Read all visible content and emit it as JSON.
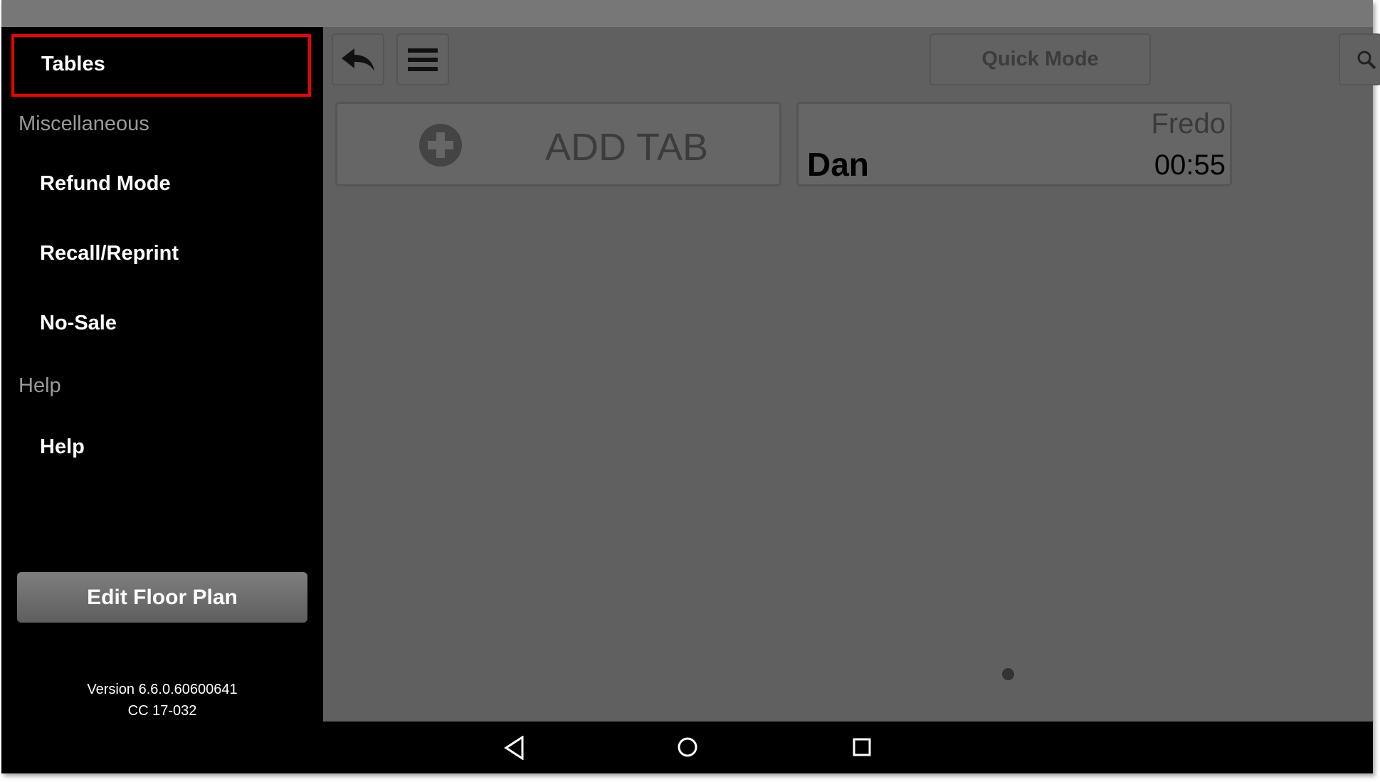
{
  "sidebar": {
    "selected": "Tables",
    "sections": [
      {
        "header": "Miscellaneous",
        "items": [
          "Refund Mode",
          "Recall/Reprint",
          "No-Sale"
        ]
      },
      {
        "header": "Help",
        "items": [
          "Help"
        ]
      }
    ],
    "edit_floor_plan": "Edit Floor Plan",
    "version": "Version 6.6.0.60600641",
    "cc": "CC 17-032"
  },
  "toolbar": {
    "quick_mode": "Quick Mode",
    "icons": [
      "back-arrow-icon",
      "hamburger-menu-icon",
      "search-icon"
    ]
  },
  "tabs": {
    "add_tab": "ADD TAB",
    "cards": [
      {
        "name": "Dan",
        "server": "Fredo",
        "time": "00:55"
      }
    ]
  },
  "pager": {
    "pages": 1,
    "current": 1
  },
  "colors": {
    "highlight": "#e00000",
    "main_bg": "#606060",
    "sidebar_bg": "#000000"
  }
}
